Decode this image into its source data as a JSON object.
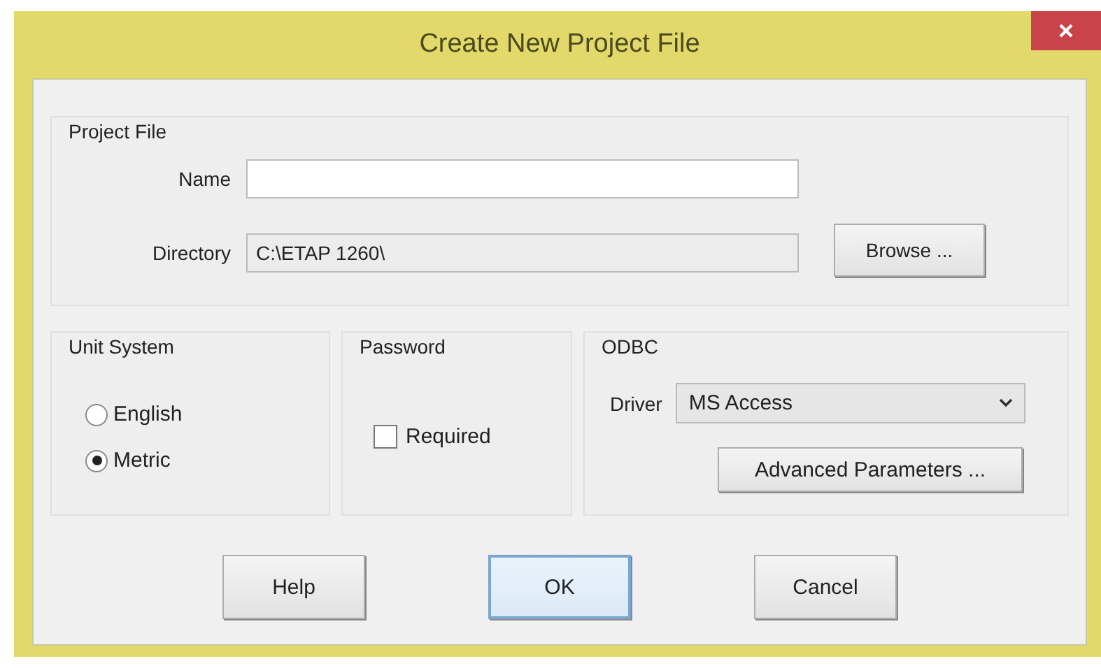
{
  "window": {
    "title": "Create New Project File"
  },
  "project_file": {
    "label": "Project File",
    "name": {
      "label": "Name"
    },
    "directory": {
      "label": "Directory",
      "value": "C:\\ETAP 1260\\"
    },
    "browse": "Browse ..."
  },
  "unit_system": {
    "label": "Unit System",
    "options": [
      {
        "label": "English",
        "selected": false
      },
      {
        "label": "Metric",
        "selected": true
      }
    ]
  },
  "password": {
    "label": "Password",
    "required": {
      "label": "Required",
      "checked": false
    }
  },
  "odbc": {
    "label": "ODBC",
    "driver": {
      "label": "Driver",
      "value": "MS Access"
    },
    "advanced": "Advanced Parameters ..."
  },
  "buttons": [
    {
      "label": "Help",
      "default": false
    },
    {
      "label": "OK",
      "default": true
    },
    {
      "label": "Cancel",
      "default": false
    }
  ]
}
